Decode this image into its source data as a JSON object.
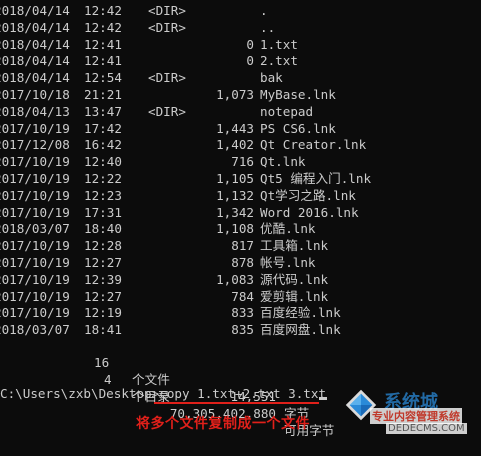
{
  "listing": [
    {
      "date": "2018/04/14",
      "time": "12:42",
      "dir": "<DIR>",
      "size": "",
      "name": "."
    },
    {
      "date": "2018/04/14",
      "time": "12:42",
      "dir": "<DIR>",
      "size": "",
      "name": ".."
    },
    {
      "date": "2018/04/14",
      "time": "12:41",
      "dir": "",
      "size": "0",
      "name": "1.txt"
    },
    {
      "date": "2018/04/14",
      "time": "12:41",
      "dir": "",
      "size": "0",
      "name": "2.txt"
    },
    {
      "date": "2018/04/14",
      "time": "12:54",
      "dir": "<DIR>",
      "size": "",
      "name": "bak"
    },
    {
      "date": "2017/10/18",
      "time": "21:21",
      "dir": "",
      "size": "1,073",
      "name": "MyBase.lnk"
    },
    {
      "date": "2018/04/13",
      "time": "13:47",
      "dir": "<DIR>",
      "size": "",
      "name": "notepad"
    },
    {
      "date": "2017/10/19",
      "time": "17:42",
      "dir": "",
      "size": "1,443",
      "name": "PS CS6.lnk"
    },
    {
      "date": "2017/12/08",
      "time": "16:42",
      "dir": "",
      "size": "1,402",
      "name": "Qt Creator.lnk"
    },
    {
      "date": "2017/10/19",
      "time": "12:40",
      "dir": "",
      "size": "716",
      "name": "Qt.lnk"
    },
    {
      "date": "2017/10/19",
      "time": "12:22",
      "dir": "",
      "size": "1,105",
      "name": "Qt5 编程入门.lnk"
    },
    {
      "date": "2017/10/19",
      "time": "12:23",
      "dir": "",
      "size": "1,132",
      "name": "Qt学习之路.lnk"
    },
    {
      "date": "2017/10/19",
      "time": "17:31",
      "dir": "",
      "size": "1,342",
      "name": "Word 2016.lnk"
    },
    {
      "date": "2018/03/07",
      "time": "18:40",
      "dir": "",
      "size": "1,108",
      "name": "优酷.lnk"
    },
    {
      "date": "2017/10/19",
      "time": "12:28",
      "dir": "",
      "size": "817",
      "name": "工具箱.lnk"
    },
    {
      "date": "2017/10/19",
      "time": "12:27",
      "dir": "",
      "size": "878",
      "name": "帐号.lnk"
    },
    {
      "date": "2017/10/19",
      "time": "12:39",
      "dir": "",
      "size": "1,083",
      "name": "源代码.lnk"
    },
    {
      "date": "2017/10/19",
      "time": "12:27",
      "dir": "",
      "size": "784",
      "name": "爱剪辑.lnk"
    },
    {
      "date": "2017/10/19",
      "time": "12:19",
      "dir": "",
      "size": "833",
      "name": "百度经验.lnk"
    },
    {
      "date": "2018/03/07",
      "time": "18:41",
      "dir": "",
      "size": "835",
      "name": "百度网盘.lnk"
    }
  ],
  "summary": {
    "files_count": "16",
    "files_label": "个文件",
    "files_bytes": "14,551",
    "files_unit": "字节",
    "dirs_count": "4",
    "dirs_label": "个目录",
    "dirs_bytes": "70,305,402,880",
    "dirs_unit": "可用字节"
  },
  "prompt": {
    "path": "C:\\Users\\zxb\\Desktop>",
    "command": "copy 1.txt+2.txt 3.txt"
  },
  "caption": "将多个文件复制成一个文件",
  "watermark": {
    "brand": "系统城",
    "tagline": "专业内容管理系统",
    "site": "DEDECMS.COM"
  },
  "colors": {
    "background": "#0c0c0c",
    "text": "#cccccc",
    "highlight": "#e0201a"
  }
}
